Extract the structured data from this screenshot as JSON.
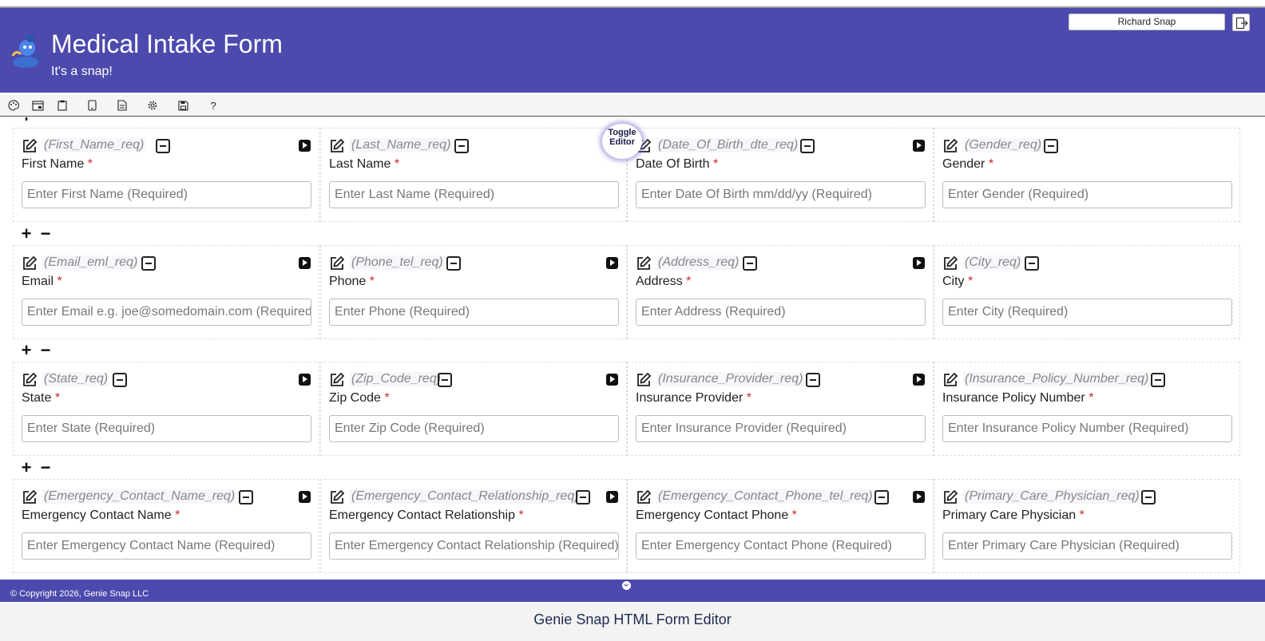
{
  "header": {
    "title": "Medical Intake Form",
    "subtitle": "It's a snap!",
    "user": "Richard Snap",
    "logo_icon": "genie-logo-icon",
    "logout_icon": "logout-icon"
  },
  "toolbar": {
    "icons": [
      "palette-icon",
      "window-icon",
      "clipboard-icon",
      "tablet-icon",
      "document-icon",
      "gear-icon",
      "save-icon",
      "help-icon"
    ],
    "help_label": "?"
  },
  "row_controls": {
    "add": "+",
    "remove": "−"
  },
  "toggle_editor": "Toggle Editor",
  "rows": [
    [
      {
        "fname": "(First_Name_req)",
        "label": "First Name",
        "placeholder": "Enter First Name (Required)"
      },
      {
        "fname": "(Last_Name_req)",
        "label": "Last Name",
        "placeholder": "Enter Last Name (Required)"
      },
      {
        "fname": "(Date_Of_Birth_dte_req)",
        "label": "Date Of Birth",
        "placeholder": "Enter Date Of Birth mm/dd/yy  (Required)"
      },
      {
        "fname": "(Gender_req)",
        "label": "Gender",
        "placeholder": "Enter Gender (Required)"
      }
    ],
    [
      {
        "fname": "(Email_eml_req)",
        "label": "Email",
        "placeholder": "Enter Email  e.g. joe@somedomain.com (Required)"
      },
      {
        "fname": "(Phone_tel_req)",
        "label": "Phone",
        "placeholder": "Enter Phone (Required)"
      },
      {
        "fname": "(Address_req)",
        "label": "Address",
        "placeholder": "Enter Address (Required)"
      },
      {
        "fname": "(City_req)",
        "label": "City",
        "placeholder": "Enter City (Required)"
      }
    ],
    [
      {
        "fname": "(State_req)",
        "label": "State",
        "placeholder": "Enter State (Required)"
      },
      {
        "fname": "(Zip_Code_req)",
        "label": "Zip Code",
        "placeholder": "Enter Zip Code (Required)"
      },
      {
        "fname": "(Insurance_Provider_req)",
        "label": "Insurance Provider",
        "placeholder": "Enter Insurance Provider (Required)"
      },
      {
        "fname": "(Insurance_Policy_Number_req)",
        "label": "Insurance Policy Number",
        "placeholder": "Enter Insurance Policy Number (Required)"
      }
    ],
    [
      {
        "fname": "(Emergency_Contact_Name_req)",
        "label": "Emergency Contact Name",
        "placeholder": "Enter Emergency Contact Name (Required)"
      },
      {
        "fname": "(Emergency_Contact_Relationship_req)",
        "label": "Emergency Contact Relationship",
        "placeholder": "Enter Emergency Contact Relationship (Required)"
      },
      {
        "fname": "(Emergency_Contact_Phone_tel_req)",
        "label": "Emergency Contact Phone",
        "placeholder": "Enter Emergency Contact Phone (Required)"
      },
      {
        "fname": "(Primary_Care_Physician_req)",
        "label": "Primary Care Physician",
        "placeholder": "Enter Primary Care Physician (Required)"
      }
    ]
  ],
  "required_mark": "*",
  "footer": {
    "copyright": "© Copyright 2026, Genie Snap LLC",
    "app_title": "Genie Snap HTML Form Editor"
  },
  "colors": {
    "header_bg": "#4d4aad",
    "required": "#c62828"
  }
}
